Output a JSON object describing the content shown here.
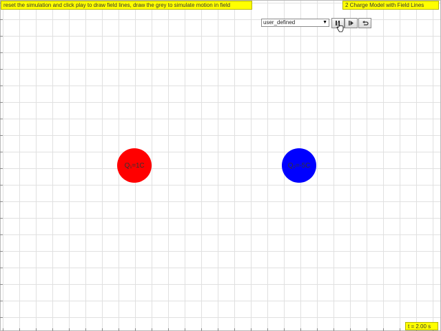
{
  "header": {
    "instruction": "reset the simulation and click play to draw field lines, draw the grey to simulate motion in field",
    "title": "2 Charge Model with Field Lines"
  },
  "controls": {
    "model_select_value": "user_defined",
    "pause_icon": "pause-icon",
    "step_icon": "step-forward-icon",
    "reset_icon": "reset-icon"
  },
  "charges": [
    {
      "label": "Q₁=1C",
      "color": "#ff0000"
    },
    {
      "label": "Q₂=-5C",
      "color": "#0000ff"
    }
  ],
  "status": {
    "time": "t = 2.00 s"
  },
  "colors": {
    "panel": "#ffff00",
    "grid": "#e0e0e0"
  }
}
